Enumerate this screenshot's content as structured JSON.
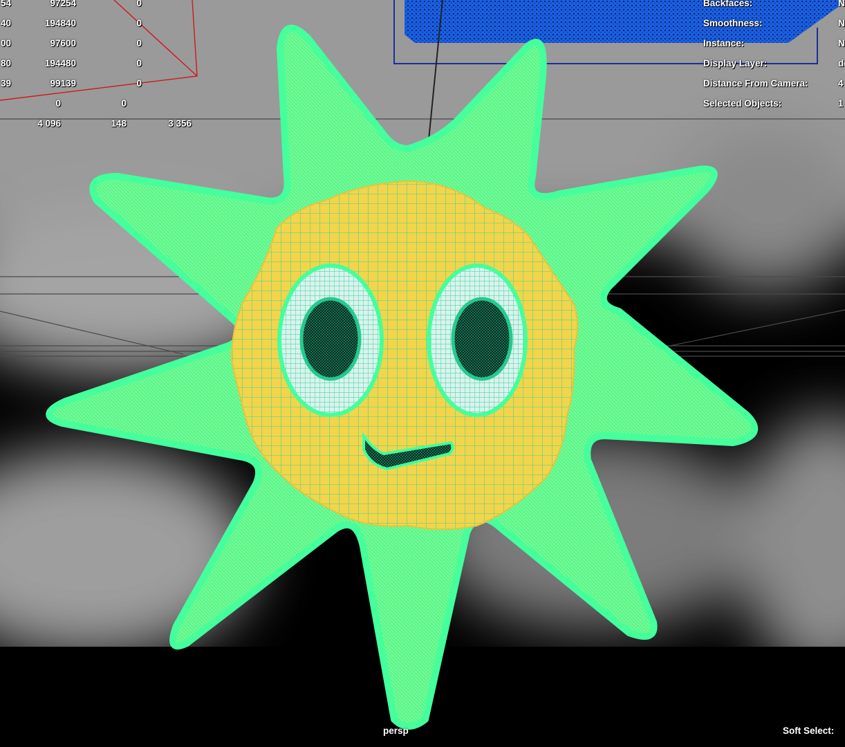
{
  "viewport": {
    "camera_label": "persp",
    "soft_select_label": "Soft Select:",
    "colors": {
      "wireframe_green": "#44ff9c",
      "body_yellow": "#f2d54a",
      "selection_blue": "#1a5fe0",
      "camera_frustum_red": "#d01818"
    }
  },
  "poly_count": {
    "rows": [
      [
        "54",
        "97254",
        "0"
      ],
      [
        "40",
        "194840",
        "0"
      ],
      [
        "00",
        "97600",
        "0"
      ],
      [
        "80",
        "194480",
        "0"
      ],
      [
        "39",
        "99139",
        "0"
      ],
      [
        "",
        "0",
        "0"
      ]
    ],
    "selection_row": [
      "4 096",
      "148",
      "3 356"
    ]
  },
  "object_info": {
    "rows": [
      {
        "label": "Backfaces:",
        "value": "N"
      },
      {
        "label": "Smoothness:",
        "value": "N"
      },
      {
        "label": "Instance:",
        "value": "N"
      },
      {
        "label": "Display Layer:",
        "value": "de"
      },
      {
        "label": "Distance From Camera:",
        "value": "4"
      },
      {
        "label": "Selected Objects:",
        "value": "1"
      }
    ]
  }
}
